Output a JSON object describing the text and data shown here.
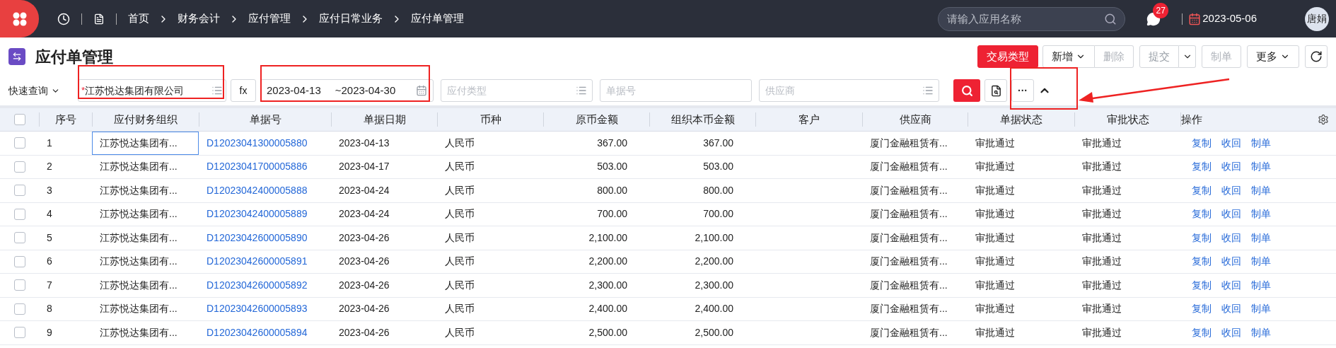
{
  "top_bar": {
    "breadcrumbs": [
      "首页",
      "财务会计",
      "应付管理",
      "应付日常业务",
      "应付单管理"
    ],
    "search": {
      "placeholder": "请输入应用名称"
    },
    "message_count": "27",
    "date": "2023-05-06",
    "user": "唐娟"
  },
  "page_title": "应付单管理",
  "actions": [
    {
      "label": "交易类型",
      "kind": "primary",
      "disabled": false,
      "dropdown": false
    },
    {
      "label": "新增",
      "kind": "group-start",
      "disabled": false,
      "dropdown": true
    },
    {
      "label": "删除",
      "kind": "group-end",
      "disabled": true,
      "dropdown": false
    },
    {
      "label": "提交",
      "kind": "split",
      "disabled": true,
      "dropdown": true
    },
    {
      "label": "制单",
      "kind": "plain",
      "disabled": true,
      "dropdown": false
    },
    {
      "label": "更多",
      "kind": "plain",
      "disabled": false,
      "dropdown": true
    }
  ],
  "filters": {
    "quick_query": "快速查询",
    "org": {
      "value": "江苏悦达集团有限公司",
      "required_mark": "*"
    },
    "fx": "fx",
    "date_from": "2023-04-13",
    "date_to": "~2023-04-30",
    "type": {
      "placeholder": "应付类型"
    },
    "doc_no": {
      "placeholder": "单据号"
    },
    "supplier": {
      "placeholder": "供应商"
    },
    "more": "···"
  },
  "table": {
    "header_checked": false,
    "columns": [
      "序号",
      "应付财务组织",
      "单据号",
      "单据日期",
      "币种",
      "原币金额",
      "组织本币金额",
      "客户",
      "供应商",
      "单据状态",
      "审批状态",
      "操作"
    ],
    "rows": [
      {
        "checked": false,
        "no": "1",
        "org": "江苏悦达集团有...",
        "org_focused": true,
        "doc": "D12023041300005880",
        "date": "2023-04-13",
        "currency": "人民币",
        "amount": "367.00",
        "local_amount": "367.00",
        "supplier": "厦门金融租赁有...",
        "doc_status": "审批通过",
        "approval": "审批通过",
        "ops": [
          "复制",
          "收回",
          "制单"
        ]
      },
      {
        "checked": false,
        "no": "2",
        "org": "江苏悦达集团有...",
        "org_focused": false,
        "doc": "D12023041700005886",
        "date": "2023-04-17",
        "currency": "人民币",
        "amount": "503.00",
        "local_amount": "503.00",
        "supplier": "厦门金融租赁有...",
        "doc_status": "审批通过",
        "approval": "审批通过",
        "ops": [
          "复制",
          "收回",
          "制单"
        ]
      },
      {
        "checked": false,
        "no": "3",
        "org": "江苏悦达集团有...",
        "org_focused": false,
        "doc": "D12023042400005888",
        "date": "2023-04-24",
        "currency": "人民币",
        "amount": "800.00",
        "local_amount": "800.00",
        "supplier": "厦门金融租赁有...",
        "doc_status": "审批通过",
        "approval": "审批通过",
        "ops": [
          "复制",
          "收回",
          "制单"
        ]
      },
      {
        "checked": false,
        "no": "4",
        "org": "江苏悦达集团有...",
        "org_focused": false,
        "doc": "D12023042400005889",
        "date": "2023-04-24",
        "currency": "人民币",
        "amount": "700.00",
        "local_amount": "700.00",
        "supplier": "厦门金融租赁有...",
        "doc_status": "审批通过",
        "approval": "审批通过",
        "ops": [
          "复制",
          "收回",
          "制单"
        ]
      },
      {
        "checked": false,
        "no": "5",
        "org": "江苏悦达集团有...",
        "org_focused": false,
        "doc": "D12023042600005890",
        "date": "2023-04-26",
        "currency": "人民币",
        "amount": "2,100.00",
        "local_amount": "2,100.00",
        "supplier": "厦门金融租赁有...",
        "doc_status": "审批通过",
        "approval": "审批通过",
        "ops": [
          "复制",
          "收回",
          "制单"
        ]
      },
      {
        "checked": false,
        "no": "6",
        "org": "江苏悦达集团有...",
        "org_focused": false,
        "doc": "D12023042600005891",
        "date": "2023-04-26",
        "currency": "人民币",
        "amount": "2,200.00",
        "local_amount": "2,200.00",
        "supplier": "厦门金融租赁有...",
        "doc_status": "审批通过",
        "approval": "审批通过",
        "ops": [
          "复制",
          "收回",
          "制单"
        ]
      },
      {
        "checked": false,
        "no": "7",
        "org": "江苏悦达集团有...",
        "org_focused": false,
        "doc": "D12023042600005892",
        "date": "2023-04-26",
        "currency": "人民币",
        "amount": "2,300.00",
        "local_amount": "2,300.00",
        "supplier": "厦门金融租赁有...",
        "doc_status": "审批通过",
        "approval": "审批通过",
        "ops": [
          "复制",
          "收回",
          "制单"
        ]
      },
      {
        "checked": false,
        "no": "8",
        "org": "江苏悦达集团有...",
        "org_focused": false,
        "doc": "D12023042600005893",
        "date": "2023-04-26",
        "currency": "人民币",
        "amount": "2,400.00",
        "local_amount": "2,400.00",
        "supplier": "厦门金融租赁有...",
        "doc_status": "审批通过",
        "approval": "审批通过",
        "ops": [
          "复制",
          "收回",
          "制单"
        ]
      },
      {
        "checked": false,
        "no": "9",
        "org": "江苏悦达集团有...",
        "org_focused": false,
        "doc": "D12023042600005894",
        "date": "2023-04-26",
        "currency": "人民币",
        "amount": "2,500.00",
        "local_amount": "2,500.00",
        "supplier": "厦门金融租赁有...",
        "doc_status": "审批通过",
        "approval": "审批通过",
        "ops": [
          "复制",
          "收回",
          "制单"
        ]
      }
    ]
  }
}
